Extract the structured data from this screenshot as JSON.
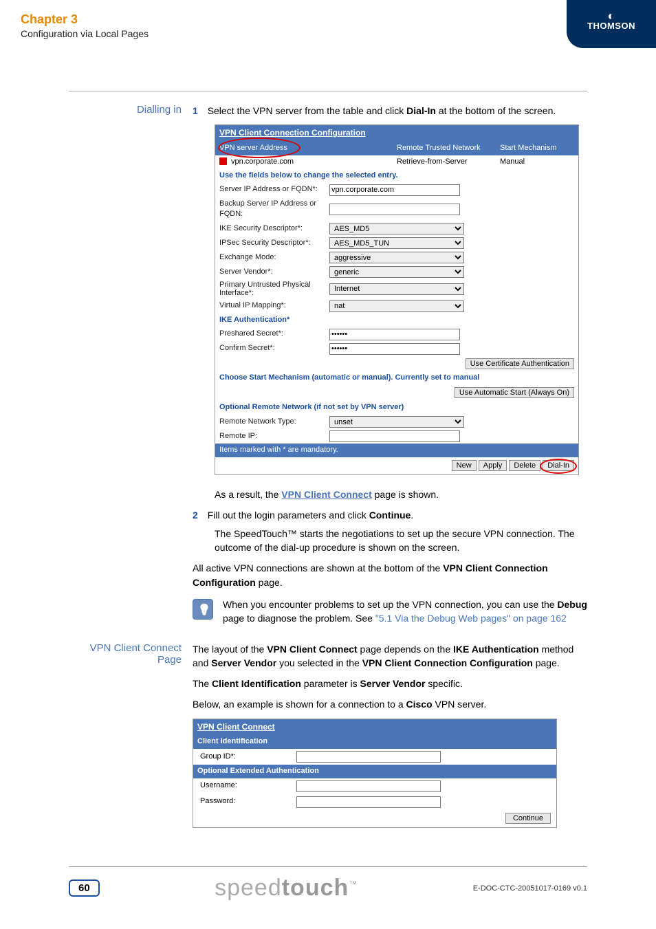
{
  "header": {
    "chapter": "Chapter 3",
    "subtitle": "Configuration via Local Pages",
    "logo": "THOMSON"
  },
  "sidebar": {
    "label1": "Dialling in",
    "label2": "VPN Client Connect Page"
  },
  "steps": {
    "s1_num": "1",
    "s1_a": "Select the VPN server from the table and click ",
    "s1_b": "Dial-In",
    "s1_c": " at the bottom of the screen.",
    "result_a": "As a result, the ",
    "result_link": "VPN Client Connect",
    "result_b": " page is shown.",
    "s2_num": "2",
    "s2_a": "Fill out the login parameters and click ",
    "s2_b": "Continue",
    "s2_c": ".",
    "s2_p2": "The SpeedTouch™ starts the negotiations to set up the secure VPN connection. The outcome of the dial-up procedure is shown on the screen.",
    "para3_a": "All active VPN connections are shown at the bottom of the ",
    "para3_b": "VPN Client Connection Configuration",
    "para3_c": " page."
  },
  "screenshot1": {
    "title": "VPN Client Connection Configuration",
    "thead": {
      "a": "VPN server Address",
      "b": "Remote Trusted Network",
      "c": "Start Mechanism"
    },
    "row": {
      "a": "vpn.corporate.com",
      "b": "Retrieve-from-Server",
      "c": "Manual"
    },
    "section_use_fields": "Use the fields below to change the selected entry.",
    "fields": {
      "server_ip_lbl": "Server IP Address or FQDN*:",
      "server_ip_val": "vpn.corporate.com",
      "backup_lbl": "Backup Server IP Address or FQDN:",
      "backup_val": "",
      "ike_desc_lbl": "IKE Security Descriptor*:",
      "ike_desc_val": "AES_MD5",
      "ipsec_desc_lbl": "IPSec Security Descriptor*:",
      "ipsec_desc_val": "AES_MD5_TUN",
      "exchange_lbl": "Exchange Mode:",
      "exchange_val": "aggressive",
      "vendor_lbl": "Server Vendor*:",
      "vendor_val": "generic",
      "primary_if_lbl": "Primary Untrusted Physical Interface*:",
      "primary_if_val": "Internet",
      "vip_lbl": "Virtual IP Mapping*:",
      "vip_val": "nat"
    },
    "ike_auth_header": "IKE Authentication*",
    "preshared_lbl": "Preshared Secret*:",
    "preshared_val": "••••••",
    "confirm_lbl": "Confirm Secret*:",
    "confirm_val": "••••••",
    "btn_cert": "Use Certificate Authentication",
    "start_mech_header": "Choose Start Mechanism (automatic or manual). Currently set to manual",
    "btn_auto": "Use Automatic Start (Always On)",
    "opt_remote_header": "Optional Remote Network (if not set by VPN server)",
    "remote_type_lbl": "Remote Network Type:",
    "remote_type_val": "unset",
    "remote_ip_lbl": "Remote IP:",
    "remote_ip_val": "",
    "mandatory_note": "Items marked with * are mandatory.",
    "btn_new": "New",
    "btn_apply": "Apply",
    "btn_delete": "Delete",
    "btn_dialin": "Dial-In"
  },
  "tip": {
    "a": "When you encounter problems to set up the VPN connection, you can use the ",
    "b": "Debug",
    "c": " page to diagnose the problem. See ",
    "link": "\"5.1 Via the Debug Web pages\" on page 162"
  },
  "section2": {
    "p1_a": "The layout of the ",
    "p1_b": "VPN Client Connect",
    "p1_c": " page depends on the ",
    "p1_d": "IKE Authentication",
    "p1_e": " method and ",
    "p1_f": "Server Vendor",
    "p1_g": " you selected in the ",
    "p1_h": "VPN Client Connection Configuration",
    "p1_i": " page.",
    "p2_a": "The ",
    "p2_b": "Client Identification",
    "p2_c": " parameter is ",
    "p2_d": "Server Vendor",
    "p2_e": " specific.",
    "p3_a": "Below, an example is shown for a connection to a ",
    "p3_b": "Cisco",
    "p3_c": " VPN server."
  },
  "screenshot2": {
    "title": "VPN Client Connect",
    "section_client": "Client Identification",
    "group_lbl": "Group ID*:",
    "section_ext": "Optional Extended Authentication",
    "user_lbl": "Username:",
    "pass_lbl": "Password:",
    "btn_continue": "Continue"
  },
  "footer": {
    "page": "60",
    "brand_a": "speed",
    "brand_b": "touch",
    "docid": "E-DOC-CTC-20051017-0169 v0.1"
  }
}
